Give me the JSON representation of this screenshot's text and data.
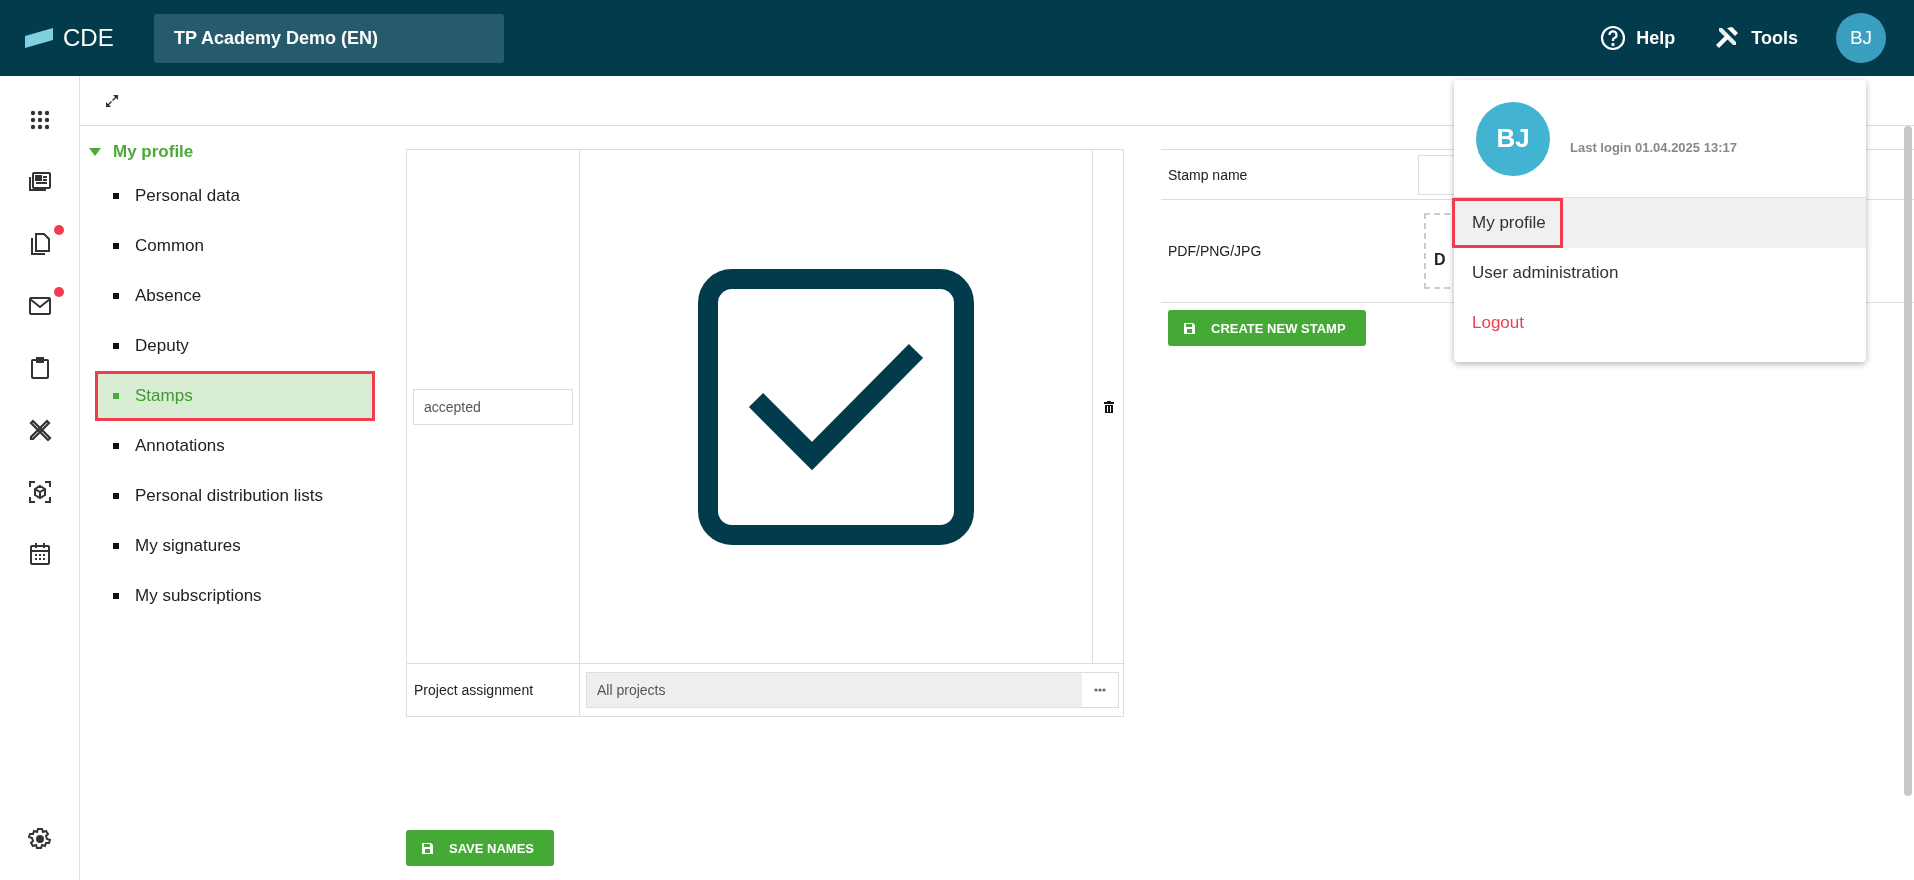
{
  "header": {
    "logo": "CDE",
    "project": "TP Academy Demo (EN)",
    "help": "Help",
    "tools": "Tools",
    "avatar": "BJ"
  },
  "rail": [
    {
      "kind": "apps",
      "badge": false
    },
    {
      "kind": "news",
      "badge": false
    },
    {
      "kind": "documents",
      "badge": true
    },
    {
      "kind": "mail",
      "badge": true
    },
    {
      "kind": "clipboard",
      "badge": false
    },
    {
      "kind": "tools",
      "badge": false
    },
    {
      "kind": "cube",
      "badge": false
    },
    {
      "kind": "calendar",
      "badge": false
    },
    {
      "kind": "settings",
      "badge": false
    }
  ],
  "tree": {
    "label": "My profile",
    "expanded": true,
    "children": [
      {
        "label": "Personal data",
        "selected": false,
        "annotated": false
      },
      {
        "label": "Common",
        "selected": false,
        "annotated": false
      },
      {
        "label": "Absence",
        "selected": false,
        "annotated": false
      },
      {
        "label": "Deputy",
        "selected": false,
        "annotated": false
      },
      {
        "label": "Stamps",
        "selected": true,
        "annotated": true
      },
      {
        "label": "Annotations",
        "selected": false,
        "annotated": false
      },
      {
        "label": "Personal distribution lists",
        "selected": false,
        "annotated": false
      },
      {
        "label": "My signatures",
        "selected": false,
        "annotated": false
      },
      {
        "label": "My subscriptions",
        "selected": false,
        "annotated": false
      }
    ]
  },
  "stamps": [
    {
      "name": "accepted",
      "project_label": "Project assignment",
      "project_value": "All projects"
    }
  ],
  "save_button": "SAVE NAMES",
  "new_stamp": {
    "name_label": "Stamp name",
    "file_label": "PDF/PNG/JPG",
    "dropzone_text": "D",
    "create_button": "CREATE NEW STAMP"
  },
  "user_menu": {
    "avatar": "BJ",
    "last_login": "Last login 01.04.2025 13:17",
    "items": [
      {
        "label": "My profile",
        "kind": "normal",
        "selected": true,
        "annotated": true
      },
      {
        "label": "User administration",
        "kind": "normal",
        "selected": false,
        "annotated": false
      },
      {
        "label": "Logout",
        "kind": "danger",
        "selected": false,
        "annotated": false
      }
    ]
  }
}
